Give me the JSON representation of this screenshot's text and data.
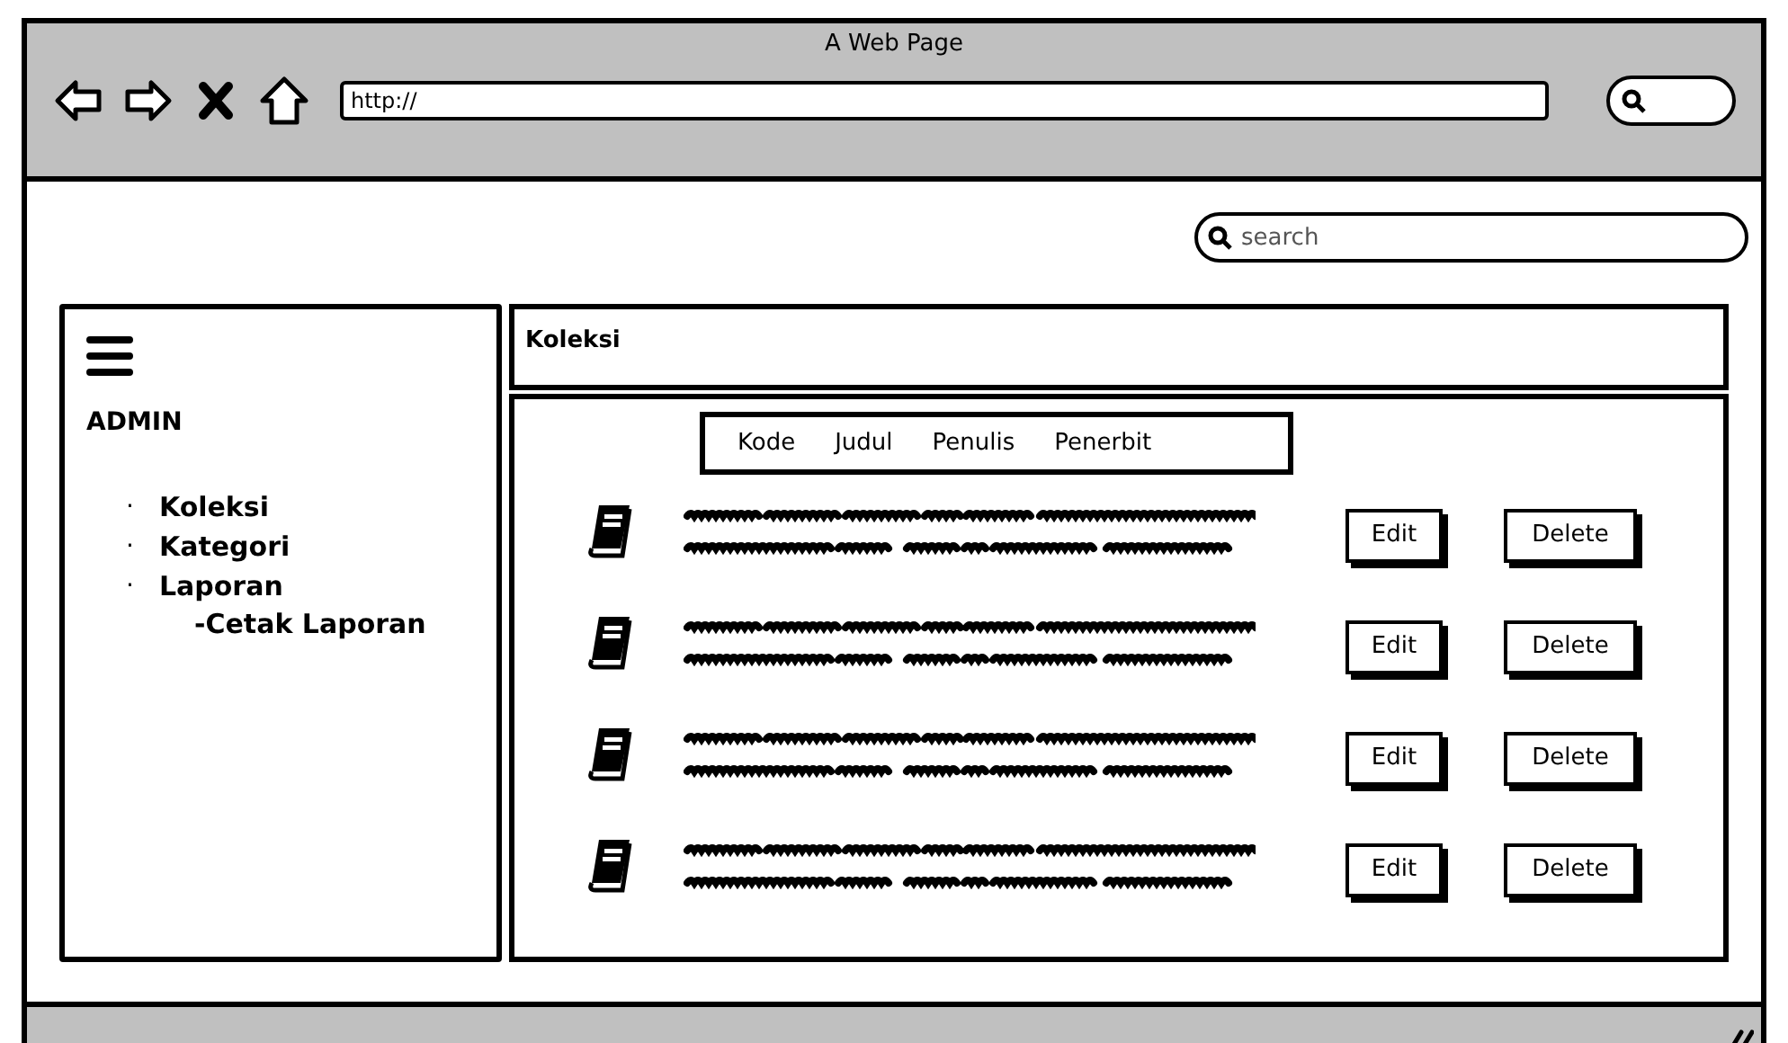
{
  "window": {
    "title": "A Web Page",
    "address": "http://"
  },
  "page": {
    "search": {
      "placeholder": "search"
    }
  },
  "sidebar": {
    "heading": "ADMIN",
    "items": [
      {
        "bullet": "·",
        "label": "Koleksi"
      },
      {
        "bullet": "·",
        "label": "Kategori"
      },
      {
        "bullet": "·",
        "label": "Laporan",
        "children": [
          {
            "label": "-Cetak Laporan"
          }
        ]
      }
    ]
  },
  "panel": {
    "title": "Koleksi",
    "columns": [
      "Kode",
      "Judul",
      "Penulis",
      "Penerbit"
    ],
    "rows": [
      {
        "actions": [
          "Edit",
          "Delete"
        ]
      },
      {
        "actions": [
          "Edit",
          "Delete"
        ]
      },
      {
        "actions": [
          "Edit",
          "Delete"
        ]
      },
      {
        "actions": [
          "Edit",
          "Delete"
        ]
      }
    ]
  }
}
